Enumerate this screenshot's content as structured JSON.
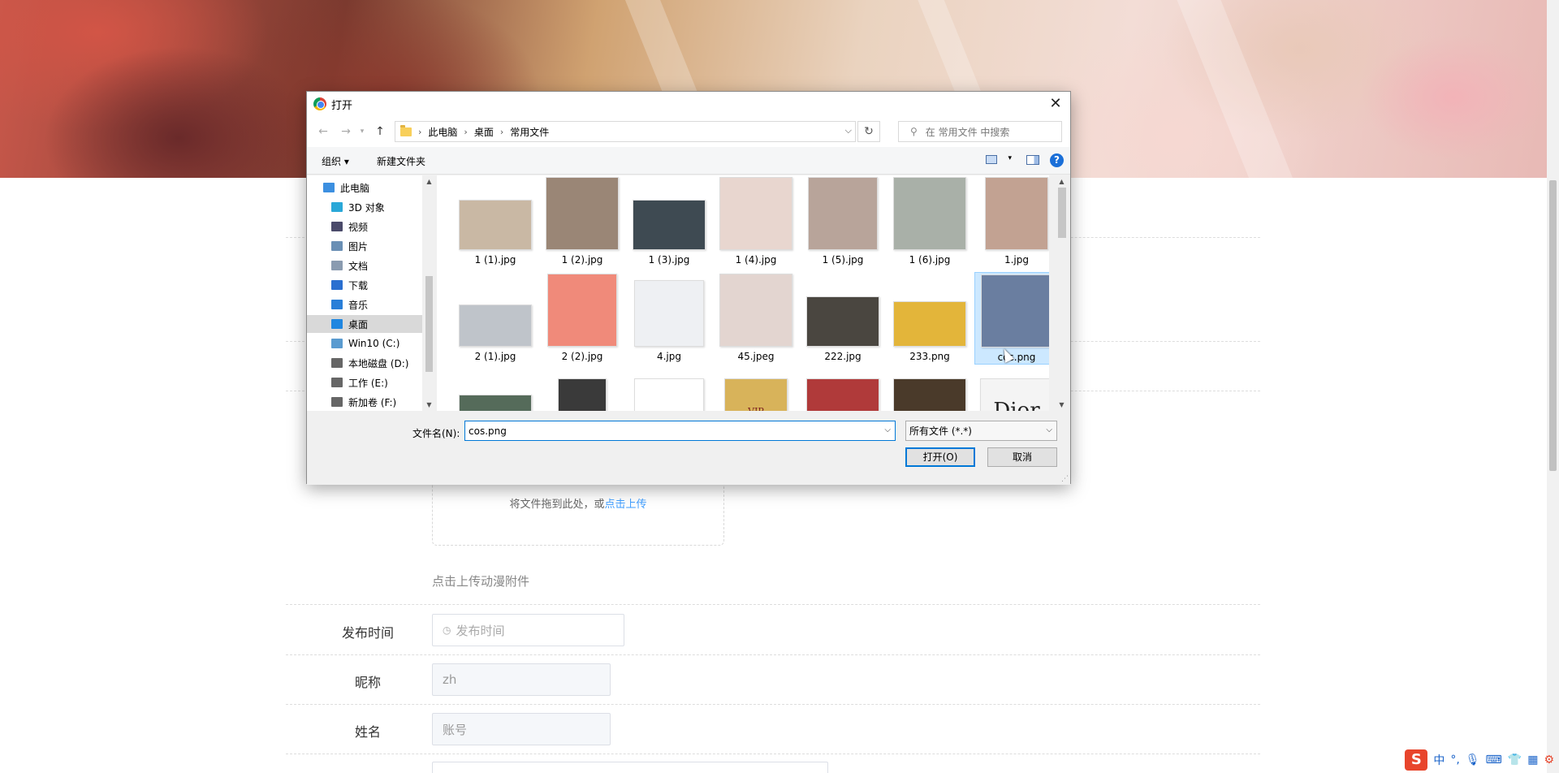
{
  "page": {
    "form": {
      "upload_hint_prefix": "将文件拖到此处，或",
      "upload_hint_link": "点击上传",
      "upload_tip": "点击上传动漫附件",
      "publish_time_label": "发布时间",
      "publish_time_placeholder": "发布时间",
      "nickname_label": "昵称",
      "nickname_value": "zh",
      "name_label": "姓名",
      "name_placeholder": "账号"
    }
  },
  "dialog": {
    "title": "打开",
    "breadcrumb": [
      "此电脑",
      "桌面",
      "常用文件"
    ],
    "search_placeholder": "在 常用文件 中搜索",
    "toolbar": {
      "organize": "组织 ▾",
      "new_folder": "新建文件夹"
    },
    "tree": [
      {
        "label": "此电脑",
        "icon": "computer-icon",
        "color": "#3c8fe0"
      },
      {
        "label": "3D 对象",
        "icon": "cube-icon",
        "color": "#2aa8d8"
      },
      {
        "label": "视频",
        "icon": "video-icon",
        "color": "#4a4a6a"
      },
      {
        "label": "图片",
        "icon": "picture-icon",
        "color": "#6a8fb5"
      },
      {
        "label": "文档",
        "icon": "document-icon",
        "color": "#8a9bb0"
      },
      {
        "label": "下载",
        "icon": "download-icon",
        "color": "#2a6fd0"
      },
      {
        "label": "音乐",
        "icon": "music-icon",
        "color": "#2a7fd8"
      },
      {
        "label": "桌面",
        "icon": "desktop-icon",
        "color": "#1f86e0"
      },
      {
        "label": "Win10 (C:)",
        "icon": "drive-icon",
        "color": "#5a9bd0"
      },
      {
        "label": "本地磁盘 (D:)",
        "icon": "drive-icon",
        "color": "#666"
      },
      {
        "label": "工作 (E:)",
        "icon": "drive-icon",
        "color": "#666"
      },
      {
        "label": "新加卷 (F:)",
        "icon": "drive-icon",
        "color": "#666"
      }
    ],
    "selected_tree_item": "桌面",
    "files": [
      {
        "name": "1 (1).jpg",
        "color": "#c9b8a4"
      },
      {
        "name": "1 (2).jpg",
        "color": "#9a8676"
      },
      {
        "name": "1 (3).jpg",
        "color": "#3e4a52"
      },
      {
        "name": "1 (4).jpg",
        "color": "#e8d6cf"
      },
      {
        "name": "1 (5).jpg",
        "color": "#b8a49a"
      },
      {
        "name": "1 (6).jpg",
        "color": "#a9b0a8"
      },
      {
        "name": "1.jpg",
        "color": "#c2a292"
      },
      {
        "name": "2 (1).jpg",
        "color": "#bfc4ca"
      },
      {
        "name": "2 (2).jpg",
        "color": "#f08a7a"
      },
      {
        "name": "4.jpg",
        "color": "#eef0f3"
      },
      {
        "name": "45.jpeg",
        "color": "#e3d5d0"
      },
      {
        "name": "222.jpg",
        "color": "#4a4640"
      },
      {
        "name": "233.png",
        "color": "#e3b53a"
      },
      {
        "name": "cos.png",
        "color": "#6a7ea0"
      },
      {
        "name": "",
        "color": "#556b5a"
      },
      {
        "name": "",
        "color": "#3a3a3a"
      },
      {
        "name": "",
        "color": "#ffffff"
      },
      {
        "name": "",
        "color": "#d8b35a"
      },
      {
        "name": "",
        "color": "#b03a3a"
      },
      {
        "name": "",
        "color": "#4a3a2a"
      },
      {
        "name": "",
        "color": "#f4f4f4"
      }
    ],
    "selected_file": "cos.png",
    "filename_label": "文件名(N):",
    "filename_value": "cos.png",
    "filetype_value": "所有文件 (*.*)",
    "open_button": "打开(O)",
    "cancel_button": "取消",
    "third_row_labels": [
      "",
      "",
      "",
      "VIP",
      "",
      "",
      "Dior"
    ]
  },
  "tray": {
    "ime_logo": "S",
    "ime_mode": "中",
    "punct": "°,",
    "extra": "⌨"
  }
}
